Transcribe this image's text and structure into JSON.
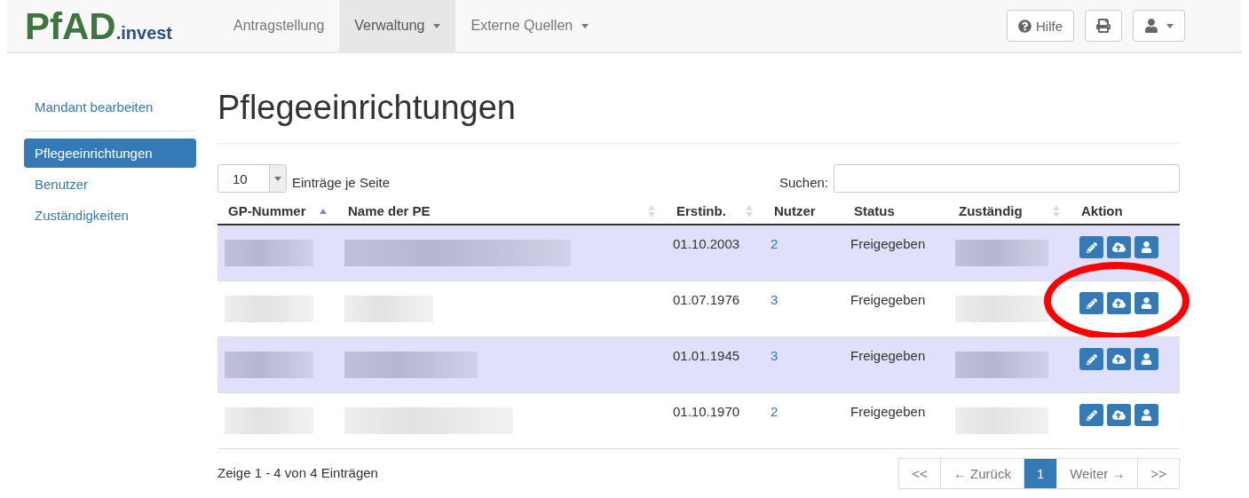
{
  "logo": {
    "main": "PfAD",
    "suffix": ".invest"
  },
  "nav": [
    {
      "label": "Antragstellung",
      "dropdown": false,
      "selected": false
    },
    {
      "label": "Verwaltung",
      "dropdown": true,
      "selected": true
    },
    {
      "label": "Externe Quellen",
      "dropdown": true,
      "selected": false
    }
  ],
  "toolbar": {
    "help": "Hilfe"
  },
  "sidebar": {
    "top": [
      {
        "label": "Mandant bearbeiten",
        "selected": false
      }
    ],
    "items": [
      {
        "label": "Pflegeeinrichtungen",
        "selected": true
      },
      {
        "label": "Benutzer",
        "selected": false
      },
      {
        "label": "Zuständigkeiten",
        "selected": false
      }
    ]
  },
  "title": "Pflegeeinrichtungen",
  "page_size": {
    "value": "10",
    "label": "Einträge je Seite"
  },
  "search": {
    "label": "Suchen:"
  },
  "table": {
    "columns": [
      {
        "label": "GP-Nummer",
        "sortable": true,
        "sorted": true
      },
      {
        "label": "Name der PE",
        "sortable": true,
        "sorted": false
      },
      {
        "label": "Erstinb.",
        "sortable": true,
        "sorted": false
      },
      {
        "label": "Nutzer",
        "sortable": false
      },
      {
        "label": "Status",
        "sortable": false
      },
      {
        "label": "Zuständig",
        "sortable": true,
        "sorted": false
      },
      {
        "label": "Aktion",
        "sortable": false
      }
    ],
    "rows": [
      {
        "highlighted": true,
        "circled": false,
        "date": "01.10.2003",
        "users": "2",
        "status": "Freigegeben"
      },
      {
        "highlighted": false,
        "circled": true,
        "date": "01.07.1976",
        "users": "3",
        "status": "Freigegeben"
      },
      {
        "highlighted": true,
        "circled": false,
        "date": "01.01.1945",
        "users": "3",
        "status": "Freigegeben"
      },
      {
        "highlighted": false,
        "circled": false,
        "date": "01.10.1970",
        "users": "2",
        "status": "Freigegeben"
      }
    ]
  },
  "info": "Zeige 1 - 4 von 4 Einträgen",
  "pagination": [
    {
      "label": "<<",
      "selected": false
    },
    {
      "label": "← Zurück",
      "selected": false
    },
    {
      "label": "1",
      "selected": true
    },
    {
      "label": "Weiter →",
      "selected": false
    },
    {
      "label": ">>",
      "selected": false
    }
  ]
}
